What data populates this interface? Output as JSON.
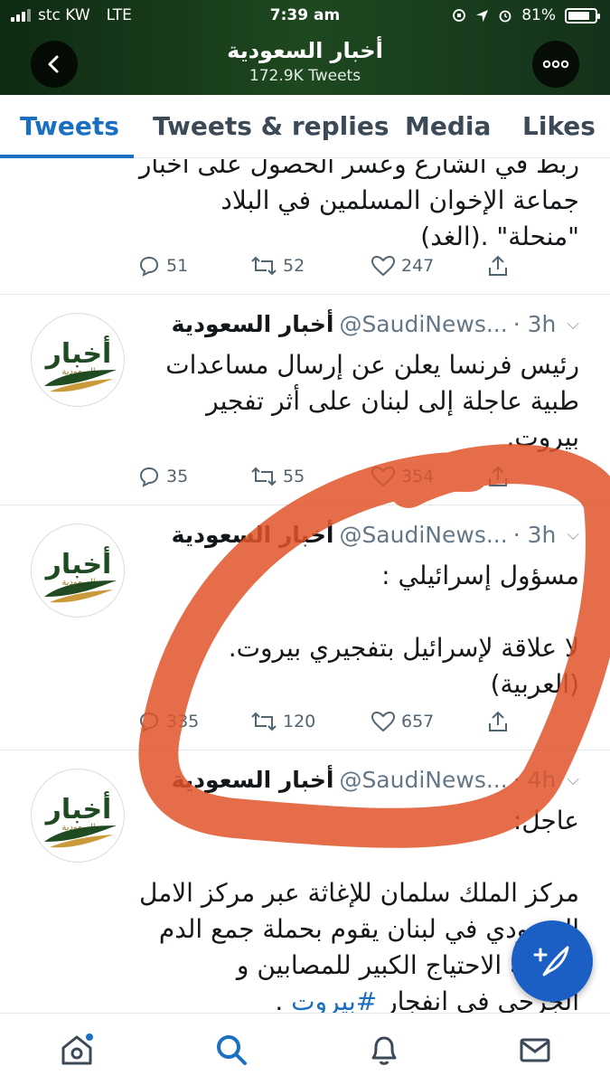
{
  "status_bar": {
    "carrier": "stc KW",
    "network": "LTE",
    "time": "7:39 am",
    "battery": "81%",
    "battery_level": 0.81
  },
  "header": {
    "title": "أخبار السعودية",
    "subtitle": "172.9K Tweets"
  },
  "tabs": [
    {
      "label": "Tweets",
      "active": true
    },
    {
      "label": "Tweets & replies"
    },
    {
      "label": "Media"
    },
    {
      "label": "Likes"
    }
  ],
  "avatar": {
    "logo_text": "أخبار",
    "logo_sub": "السعودية"
  },
  "tweets": [
    {
      "partial": true,
      "text": "ربط في الشارع وعسر الحصول على أخبار\nجماعة الإخوان المسلمين في البلاد\n\"منحلة\" .(الغد)",
      "replies": "51",
      "retweets": "52",
      "likes": "247"
    },
    {
      "name": "أخبار السعودية",
      "handle": "@SaudiNews...",
      "time": "· 3h",
      "text": "رئيس فرنسا يعلن عن إرسال مساعدات\nطبية عاجلة إلى لبنان على أثر تفجير\nبيروت.",
      "replies": "35",
      "retweets": "55",
      "likes": "354"
    },
    {
      "name": "أخبار السعودية",
      "handle": "@SaudiNews...",
      "time": "· 3h",
      "text": "مسؤول إسرائيلي :\n\nلا علاقة لإسرائيل بتفجيري بيروت.\n(العربية)",
      "replies": "335",
      "retweets": "120",
      "likes": "657"
    },
    {
      "name": "أخبار السعودية",
      "handle": "@SaudiNews...",
      "time": "· 4h",
      "text": "عاجل:\n\nمركز الملك سلمان للإغاثة عبر مركز الامل\nالسعودي في لبنان يقوم بحملة جمع الدم\nلتغطية الاحتياج الكبير للمصابين و\nالجرحى فى انفجار",
      "hashtag": "#بيروت",
      "tail": " ."
    }
  ],
  "colors": {
    "accent": "#1b6fc3",
    "header_bg": "#1e4820",
    "annotation": "#e0532a"
  }
}
